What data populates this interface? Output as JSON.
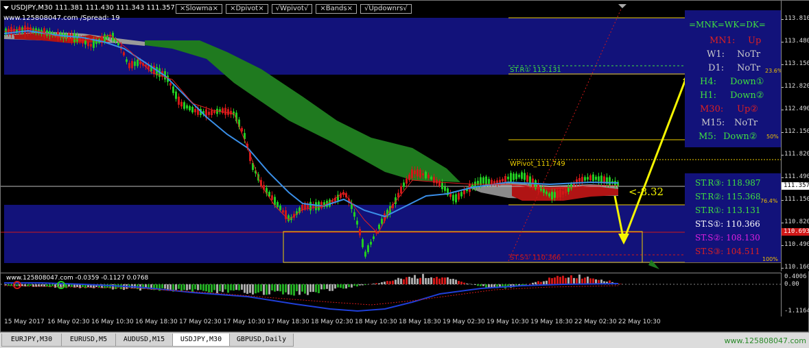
{
  "chart": {
    "symbol_header": "USDJPY,M30  111.381 111.430 111.343 111.357",
    "sub_header": "www.125808047.com /Spread:   19",
    "indicator_buttons": [
      "×Slowma×",
      "×Dpivot×",
      "√Wpivot√",
      "×Bands×",
      "√Updownrs√"
    ],
    "price_labels": [
      "113.810",
      "113.480",
      "113.150",
      "112.820",
      "112.490",
      "112.150",
      "111.820",
      "111.490",
      "111.150",
      "110.820",
      "110.490",
      "110.160"
    ],
    "current_price": "111.357",
    "red_line_price": "110.693",
    "top_zero": "0",
    "wpivot_label": "WPivot_111.749",
    "str1_label": "ST.R① 113.131",
    "sts1_label": "ST.S① 110.366",
    "fib_labels": [
      "23.6%",
      "50%",
      "76.4%",
      "100%"
    ],
    "annotation_value": "<-8.32",
    "mnk_panel": {
      "title": "=MNK=WK=DK=",
      "rows": [
        {
          "tf": "MN1:",
          "val": "Up"
        },
        {
          "tf": "W1:",
          "val": "NoTr"
        },
        {
          "tf": "D1:",
          "val": "NoTr"
        },
        {
          "tf": "H4:",
          "val": "Down①"
        },
        {
          "tf": "H1:",
          "val": "Down②"
        },
        {
          "tf": "M30:",
          "val": "Up②"
        },
        {
          "tf": "M15:",
          "val": "NoTr"
        },
        {
          "tf": "M5:",
          "val": "Down②"
        }
      ]
    },
    "levels_panel": [
      "ST.R③: 118.987",
      "ST.R②: 115.368",
      "ST.R①: 113.131",
      "ST.S①: 110.366",
      "ST.S②: 108.130",
      "ST.S③: 104.511"
    ],
    "time_labels": [
      "15 May 2017",
      "16 May 02:30",
      "16 May 10:30",
      "16 May 18:30",
      "17 May 02:30",
      "17 May 10:30",
      "17 May 18:30",
      "18 May 02:30",
      "18 May 10:30",
      "18 May 18:30",
      "19 May 02:30",
      "19 May 10:30",
      "19 May 18:30",
      "22 May 02:30",
      "22 May 10:30"
    ]
  },
  "oscillator": {
    "header": "www.125808047.com -0.0359 -0.1127 0.0768",
    "scale_labels": [
      "0.4006",
      "0.00",
      "-1.1164"
    ]
  },
  "tabs": [
    "EURJPY,M30",
    "EURUSD,M5",
    "AUDUSD,M15",
    "USDJPY,M30",
    "GBPUSD,Daily"
  ],
  "active_tab": "USDJPY,M30",
  "watermark": "www.125808047.com",
  "colors": {
    "zone_blue": "#12127a",
    "cloud_green": "#1f7a1f",
    "bull_candle": "#22cc22",
    "bear_candle": "#d01818",
    "ma_blue": "#3a8fe8",
    "ma_red": "#e02020",
    "fib_yellow": "#f0d000"
  }
}
